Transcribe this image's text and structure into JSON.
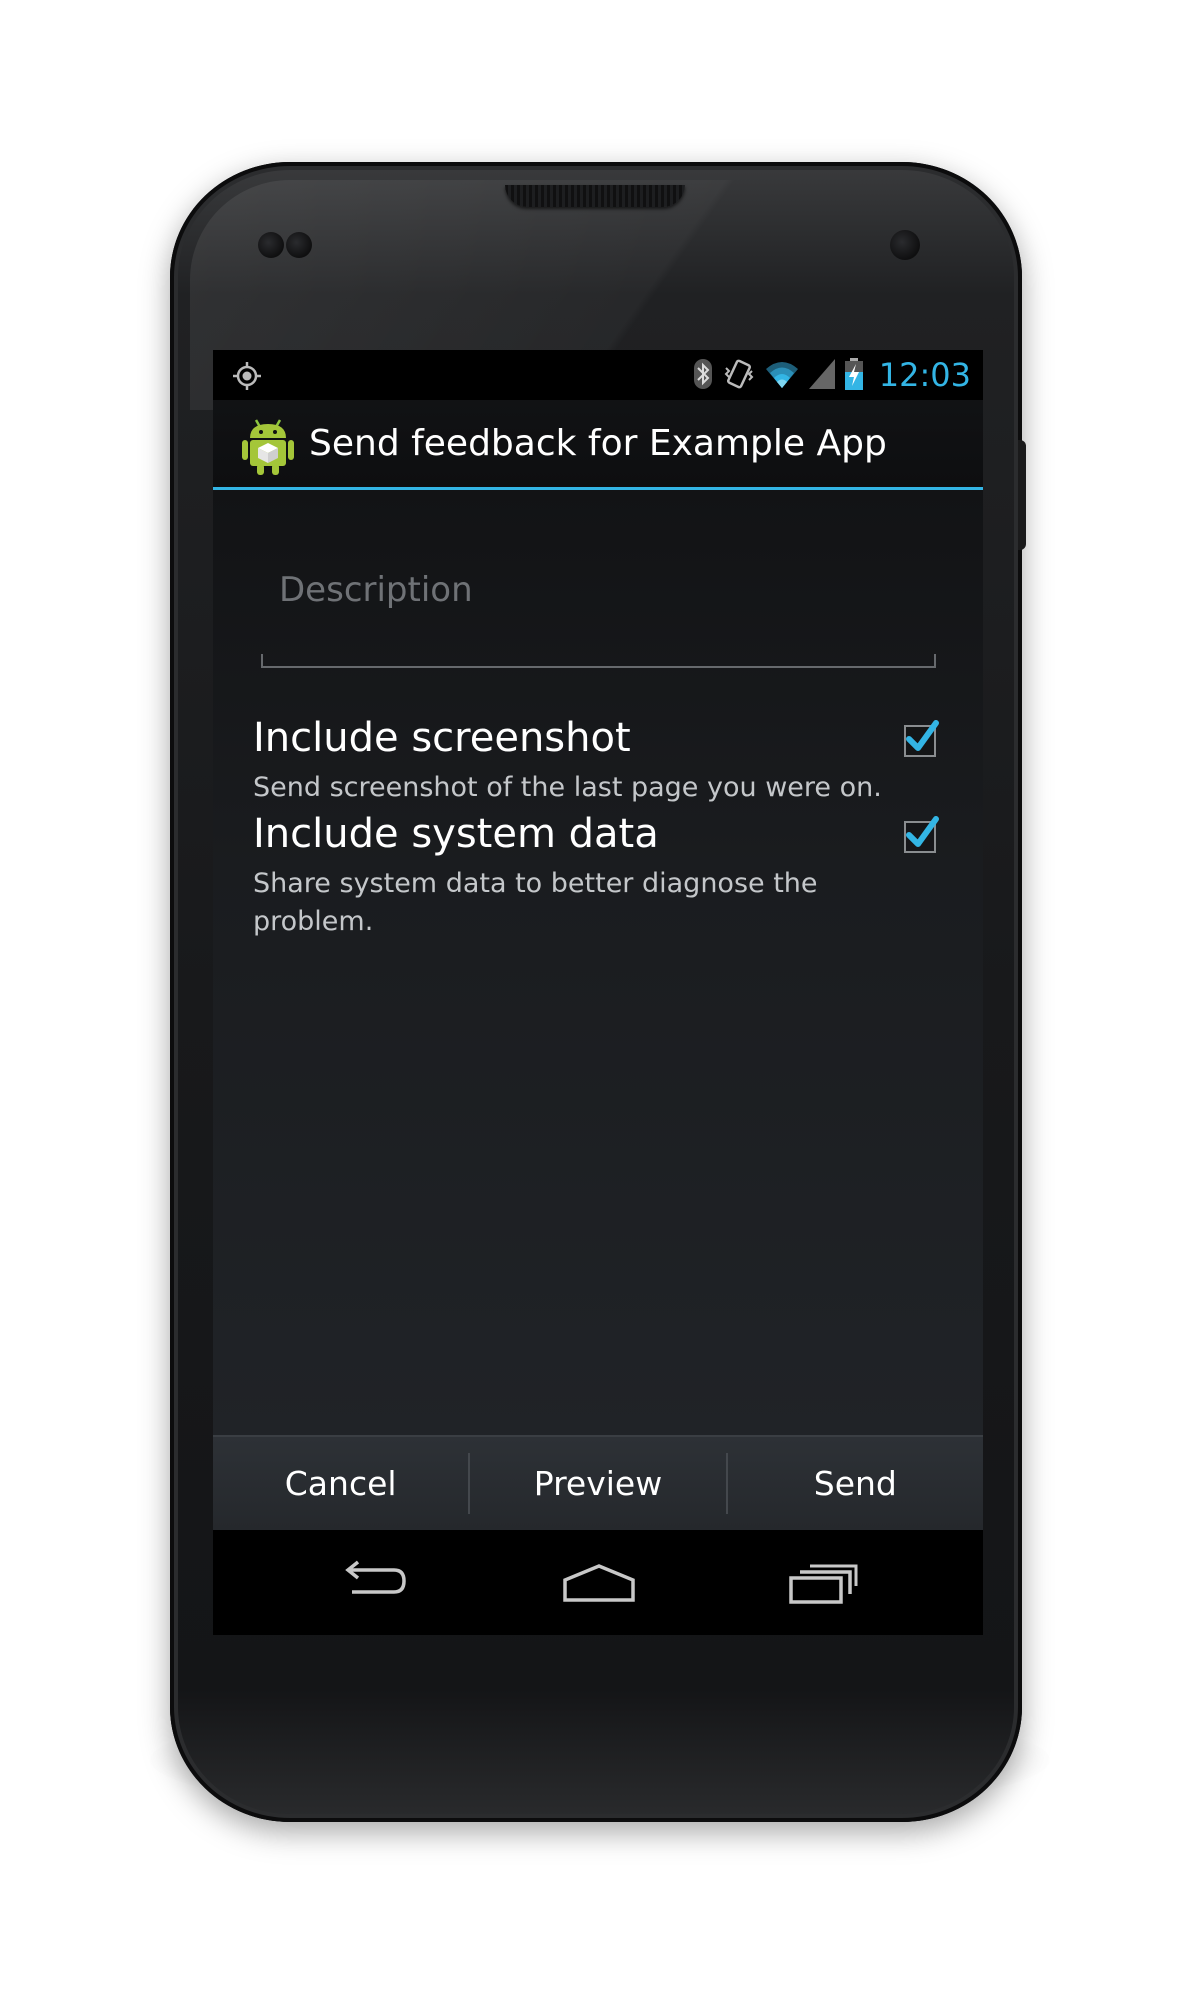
{
  "status_bar": {
    "time": "12:03",
    "icons": [
      "gps-icon",
      "bluetooth-icon",
      "vibrate-icon",
      "wifi-icon",
      "signal-icon",
      "battery-charging-icon"
    ],
    "accent_color": "#33b5e5"
  },
  "action_bar": {
    "title": "Send feedback for Example App",
    "icon": "android-app-icon"
  },
  "description": {
    "value": "",
    "placeholder": "Description"
  },
  "preferences": [
    {
      "title": "Include screenshot",
      "summary": "Send screenshot of the last page you were on.",
      "checked": true
    },
    {
      "title": "Include system data",
      "summary": "Share system data to better diagnose the problem.",
      "checked": true
    }
  ],
  "buttons": {
    "cancel": "Cancel",
    "preview": "Preview",
    "send": "Send"
  },
  "nav_bar": {
    "icons": [
      "back-icon",
      "home-icon",
      "recent-apps-icon"
    ]
  }
}
